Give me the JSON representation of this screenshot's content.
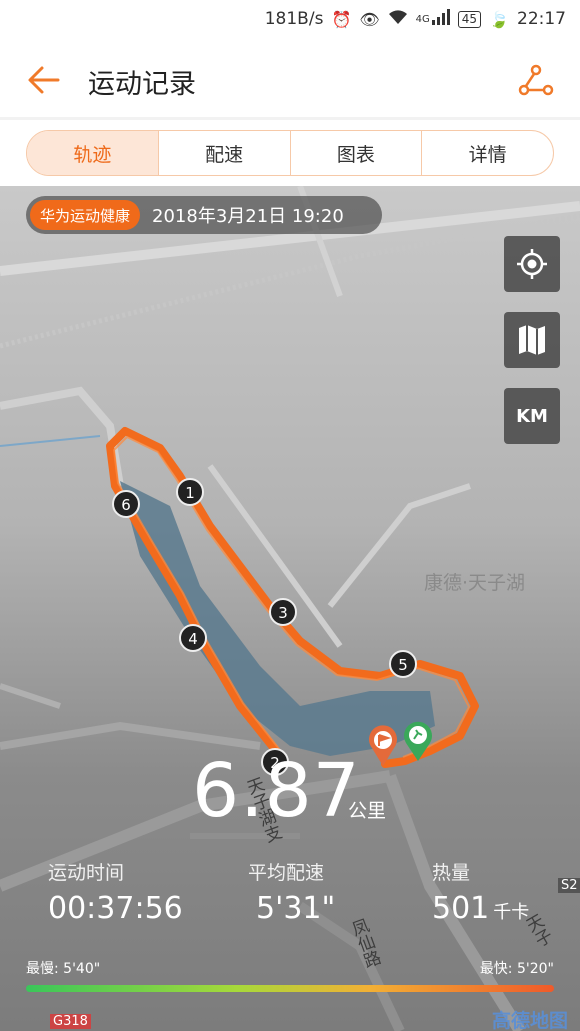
{
  "status_bar": {
    "speed": "181B/s",
    "network": "4G",
    "battery": "45",
    "time": "22:17"
  },
  "app_bar": {
    "title": "运动记录"
  },
  "tabs": [
    {
      "label": "轨迹",
      "active": true
    },
    {
      "label": "配速",
      "active": false
    },
    {
      "label": "图表",
      "active": false
    },
    {
      "label": "详情",
      "active": false
    }
  ],
  "map": {
    "brand": "华为运动健康",
    "datetime": "2018年3月21日 19:20",
    "km_button": "KM",
    "place_label": "康德·天子湖",
    "road_label_1": "天子湖支",
    "road_label_2": "凤仙路",
    "road_label_3": "天子",
    "road_code": "G318",
    "road_code_2": "S2",
    "km_markers": [
      "1",
      "2",
      "3",
      "4",
      "5",
      "6"
    ],
    "provider_logo": "高德地图"
  },
  "summary": {
    "distance": "6.87",
    "distance_unit": "公里",
    "duration_label": "运动时间",
    "duration": "00:37:56",
    "pace_label": "平均配速",
    "pace": "5'31\"",
    "calories_label": "热量",
    "calories": "501",
    "calories_unit": "千卡",
    "slowest_label": "最慢:",
    "slowest": "5'40\"",
    "fastest_label": "最快:",
    "fastest": "5'20\""
  },
  "colors": {
    "accent": "#f06a1a",
    "track": "#f26b1d"
  }
}
